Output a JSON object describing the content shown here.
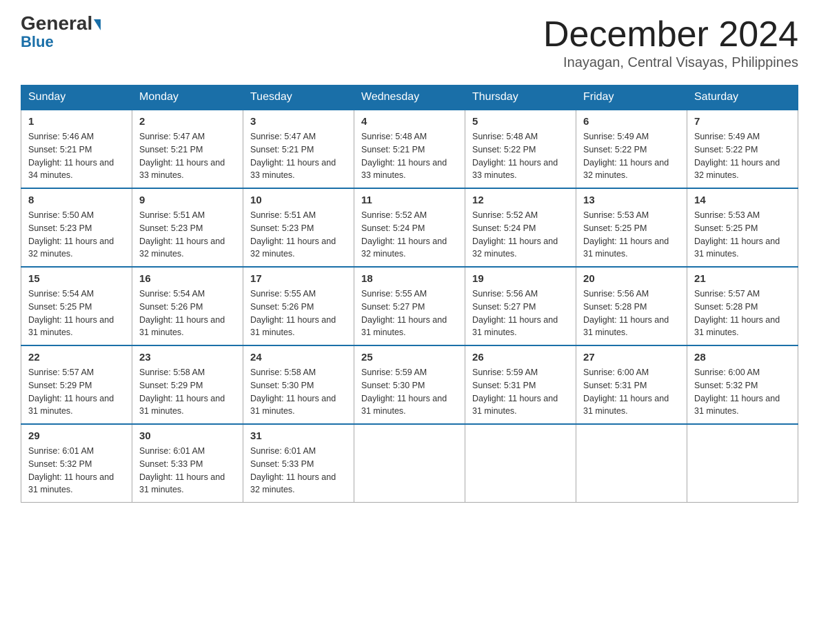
{
  "header": {
    "logo_general": "General",
    "logo_blue": "Blue",
    "month_title": "December 2024",
    "location": "Inayagan, Central Visayas, Philippines"
  },
  "days_of_week": [
    "Sunday",
    "Monday",
    "Tuesday",
    "Wednesday",
    "Thursday",
    "Friday",
    "Saturday"
  ],
  "weeks": [
    [
      {
        "day": "1",
        "sunrise": "5:46 AM",
        "sunset": "5:21 PM",
        "daylight": "11 hours and 34 minutes."
      },
      {
        "day": "2",
        "sunrise": "5:47 AM",
        "sunset": "5:21 PM",
        "daylight": "11 hours and 33 minutes."
      },
      {
        "day": "3",
        "sunrise": "5:47 AM",
        "sunset": "5:21 PM",
        "daylight": "11 hours and 33 minutes."
      },
      {
        "day": "4",
        "sunrise": "5:48 AM",
        "sunset": "5:21 PM",
        "daylight": "11 hours and 33 minutes."
      },
      {
        "day": "5",
        "sunrise": "5:48 AM",
        "sunset": "5:22 PM",
        "daylight": "11 hours and 33 minutes."
      },
      {
        "day": "6",
        "sunrise": "5:49 AM",
        "sunset": "5:22 PM",
        "daylight": "11 hours and 32 minutes."
      },
      {
        "day": "7",
        "sunrise": "5:49 AM",
        "sunset": "5:22 PM",
        "daylight": "11 hours and 32 minutes."
      }
    ],
    [
      {
        "day": "8",
        "sunrise": "5:50 AM",
        "sunset": "5:23 PM",
        "daylight": "11 hours and 32 minutes."
      },
      {
        "day": "9",
        "sunrise": "5:51 AM",
        "sunset": "5:23 PM",
        "daylight": "11 hours and 32 minutes."
      },
      {
        "day": "10",
        "sunrise": "5:51 AM",
        "sunset": "5:23 PM",
        "daylight": "11 hours and 32 minutes."
      },
      {
        "day": "11",
        "sunrise": "5:52 AM",
        "sunset": "5:24 PM",
        "daylight": "11 hours and 32 minutes."
      },
      {
        "day": "12",
        "sunrise": "5:52 AM",
        "sunset": "5:24 PM",
        "daylight": "11 hours and 32 minutes."
      },
      {
        "day": "13",
        "sunrise": "5:53 AM",
        "sunset": "5:25 PM",
        "daylight": "11 hours and 31 minutes."
      },
      {
        "day": "14",
        "sunrise": "5:53 AM",
        "sunset": "5:25 PM",
        "daylight": "11 hours and 31 minutes."
      }
    ],
    [
      {
        "day": "15",
        "sunrise": "5:54 AM",
        "sunset": "5:25 PM",
        "daylight": "11 hours and 31 minutes."
      },
      {
        "day": "16",
        "sunrise": "5:54 AM",
        "sunset": "5:26 PM",
        "daylight": "11 hours and 31 minutes."
      },
      {
        "day": "17",
        "sunrise": "5:55 AM",
        "sunset": "5:26 PM",
        "daylight": "11 hours and 31 minutes."
      },
      {
        "day": "18",
        "sunrise": "5:55 AM",
        "sunset": "5:27 PM",
        "daylight": "11 hours and 31 minutes."
      },
      {
        "day": "19",
        "sunrise": "5:56 AM",
        "sunset": "5:27 PM",
        "daylight": "11 hours and 31 minutes."
      },
      {
        "day": "20",
        "sunrise": "5:56 AM",
        "sunset": "5:28 PM",
        "daylight": "11 hours and 31 minutes."
      },
      {
        "day": "21",
        "sunrise": "5:57 AM",
        "sunset": "5:28 PM",
        "daylight": "11 hours and 31 minutes."
      }
    ],
    [
      {
        "day": "22",
        "sunrise": "5:57 AM",
        "sunset": "5:29 PM",
        "daylight": "11 hours and 31 minutes."
      },
      {
        "day": "23",
        "sunrise": "5:58 AM",
        "sunset": "5:29 PM",
        "daylight": "11 hours and 31 minutes."
      },
      {
        "day": "24",
        "sunrise": "5:58 AM",
        "sunset": "5:30 PM",
        "daylight": "11 hours and 31 minutes."
      },
      {
        "day": "25",
        "sunrise": "5:59 AM",
        "sunset": "5:30 PM",
        "daylight": "11 hours and 31 minutes."
      },
      {
        "day": "26",
        "sunrise": "5:59 AM",
        "sunset": "5:31 PM",
        "daylight": "11 hours and 31 minutes."
      },
      {
        "day": "27",
        "sunrise": "6:00 AM",
        "sunset": "5:31 PM",
        "daylight": "11 hours and 31 minutes."
      },
      {
        "day": "28",
        "sunrise": "6:00 AM",
        "sunset": "5:32 PM",
        "daylight": "11 hours and 31 minutes."
      }
    ],
    [
      {
        "day": "29",
        "sunrise": "6:01 AM",
        "sunset": "5:32 PM",
        "daylight": "11 hours and 31 minutes."
      },
      {
        "day": "30",
        "sunrise": "6:01 AM",
        "sunset": "5:33 PM",
        "daylight": "11 hours and 31 minutes."
      },
      {
        "day": "31",
        "sunrise": "6:01 AM",
        "sunset": "5:33 PM",
        "daylight": "11 hours and 32 minutes."
      },
      null,
      null,
      null,
      null
    ]
  ],
  "labels": {
    "sunrise": "Sunrise:",
    "sunset": "Sunset:",
    "daylight": "Daylight:"
  }
}
